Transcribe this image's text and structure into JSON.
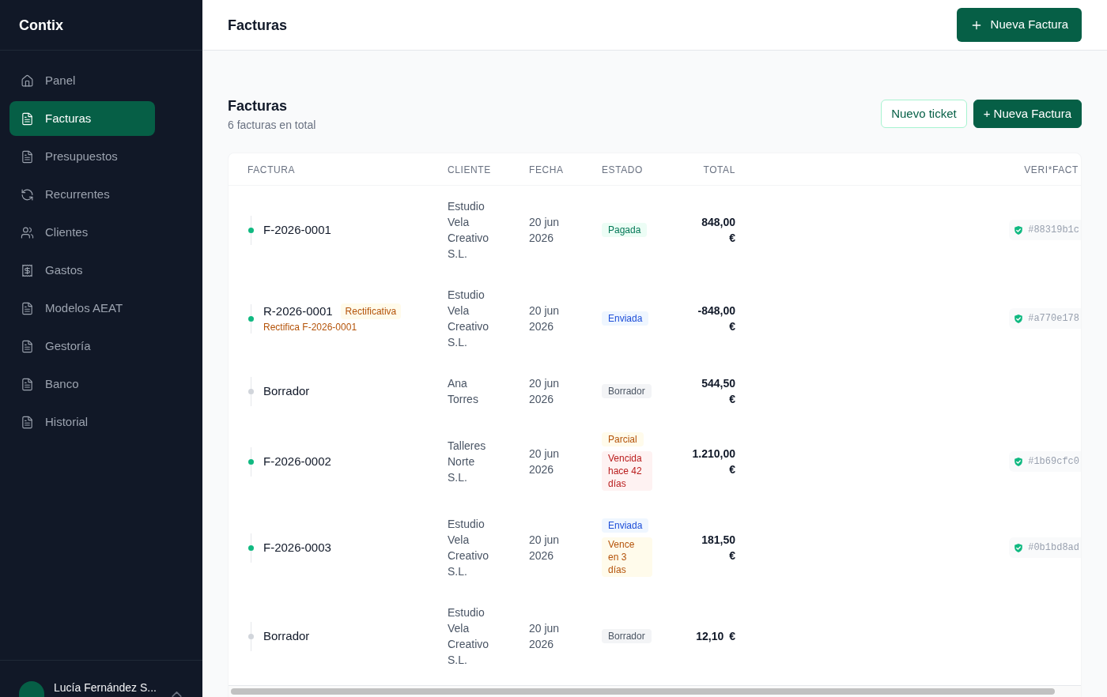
{
  "sidebar": {
    "logo": "Contix",
    "items": [
      {
        "label": "Panel",
        "selected": false
      },
      {
        "label": "Facturas",
        "selected": true
      },
      {
        "label": "Presupuestos",
        "selected": false
      },
      {
        "label": "Recurrentes",
        "selected": false
      },
      {
        "label": "Clientes",
        "selected": false
      },
      {
        "label": "Gastos",
        "selected": false
      },
      {
        "label": "Modelos AEAT",
        "selected": false
      },
      {
        "label": "Gestoría",
        "selected": false
      },
      {
        "label": "Banco",
        "selected": false
      },
      {
        "label": "Historial",
        "selected": false
      }
    ],
    "user": {
      "name": "Lucía Fernández S..."
    }
  },
  "header": {
    "title": "Facturas",
    "button": "Nueva Factura"
  },
  "section": {
    "title": "Facturas",
    "subtitle": "6 facturas en total",
    "buttons": [
      {
        "label": "Nuevo ticket",
        "kind": "outline"
      },
      {
        "label": "+ Nueva Factura",
        "kind": "primary"
      }
    ]
  },
  "table": {
    "columns": [
      "FACTURA",
      "CLIENTE",
      "FECHA",
      "ESTADO",
      "TOTAL",
      "VERI*FACT"
    ],
    "rows": [
      {
        "number": "F-2026-0001",
        "color": "#10b981",
        "client": "Estudio Vela Creativo S.L.",
        "date": "20 jun 2026",
        "statuses": [
          {
            "label": "Pagada",
            "kind": "paid"
          }
        ],
        "total": "848,00 €",
        "hash": "#88319b1c"
      },
      {
        "number": "R-2026-0001",
        "tag": "Rectificativa",
        "note": "Rectifica F-2026-0001",
        "color": "#10b981",
        "client": "Estudio Vela Creativo S.L.",
        "date": "20 jun 2026",
        "statuses": [
          {
            "label": "Enviada",
            "kind": "sent"
          }
        ],
        "total": "-848,00 €",
        "hash": "#a770e178"
      },
      {
        "number": "Borrador",
        "color": "#d1d5db",
        "client": "Ana Torres",
        "date": "20 jun 2026",
        "statuses": [
          {
            "label": "Borrador",
            "kind": "draft"
          }
        ],
        "total": "544,50 €"
      },
      {
        "number": "F-2026-0002",
        "color": "#10b981",
        "client": "Talleres Norte S.L.",
        "date": "20 jun 2026",
        "statuses": [
          {
            "label": "Parcial",
            "kind": "partial"
          },
          {
            "label": "Vencida hace 42 días",
            "kind": "overdue"
          }
        ],
        "total": "1.210,00 €",
        "hash": "#1b69cfc0"
      },
      {
        "number": "F-2026-0003",
        "color": "#10b981",
        "client": "Estudio Vela Creativo S.L.",
        "date": "20 jun 2026",
        "statuses": [
          {
            "label": "Enviada",
            "kind": "sent"
          },
          {
            "label": "Vence en 3 días",
            "kind": "due"
          }
        ],
        "total": "181,50 €",
        "hash": "#0b1bd8ad"
      },
      {
        "number": "Borrador",
        "color": "#d1d5db",
        "client": "Estudio Vela Creativo S.L.",
        "date": "20 jun 2026",
        "statuses": [
          {
            "label": "Borrador",
            "kind": "draft"
          }
        ],
        "total": "12,10 €"
      }
    ]
  }
}
